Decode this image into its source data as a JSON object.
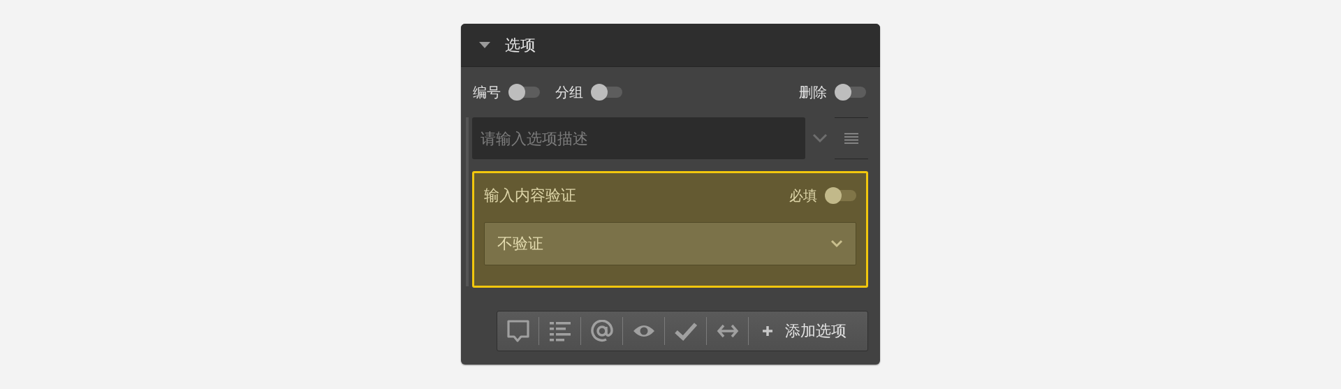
{
  "panel": {
    "title": "选项",
    "expanded": true
  },
  "toggles": [
    {
      "label": "编号",
      "on": false
    },
    {
      "label": "分组",
      "on": false
    },
    {
      "label": "删除",
      "on": false
    }
  ],
  "description": {
    "placeholder": "请输入选项描述"
  },
  "validation": {
    "title": "输入内容验证",
    "required": {
      "label": "必填",
      "on": false
    },
    "select": {
      "value": "不验证"
    }
  },
  "toolbar": {
    "tools": [
      {
        "kind": "comment"
      },
      {
        "kind": "list"
      },
      {
        "kind": "at"
      },
      {
        "kind": "eye"
      },
      {
        "kind": "check"
      },
      {
        "kind": "arrows"
      }
    ],
    "add_button": "添加选项"
  }
}
